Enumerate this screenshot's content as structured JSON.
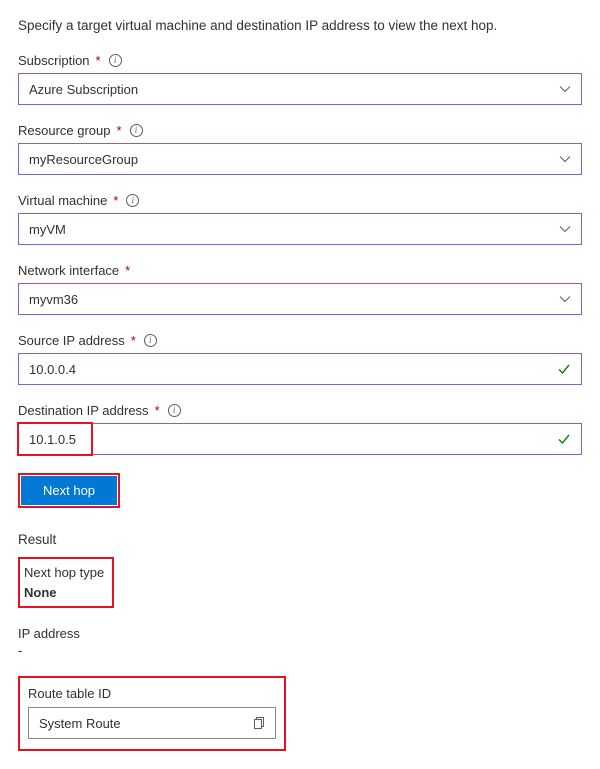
{
  "intro": "Specify a target virtual machine and destination IP address to view the next hop.",
  "fields": {
    "subscription": {
      "label": "Subscription",
      "value": "Azure Subscription"
    },
    "resourceGroup": {
      "label": "Resource group",
      "value": "myResourceGroup"
    },
    "virtualMachine": {
      "label": "Virtual machine",
      "value": "myVM"
    },
    "networkInterface": {
      "label": "Network interface",
      "value": "myvm36"
    },
    "sourceIp": {
      "label": "Source IP address",
      "value": "10.0.0.4"
    },
    "destinationIp": {
      "label": "Destination IP address",
      "value": "10.1.0.5"
    }
  },
  "button": {
    "nextHop": "Next hop"
  },
  "result": {
    "heading": "Result",
    "nextHopTypeLabel": "Next hop type",
    "nextHopTypeValue": "None",
    "ipAddressLabel": "IP address",
    "ipAddressValue": "-",
    "routeTableIdLabel": "Route table ID",
    "routeTableIdValue": "System Route"
  },
  "requiredMark": "*"
}
